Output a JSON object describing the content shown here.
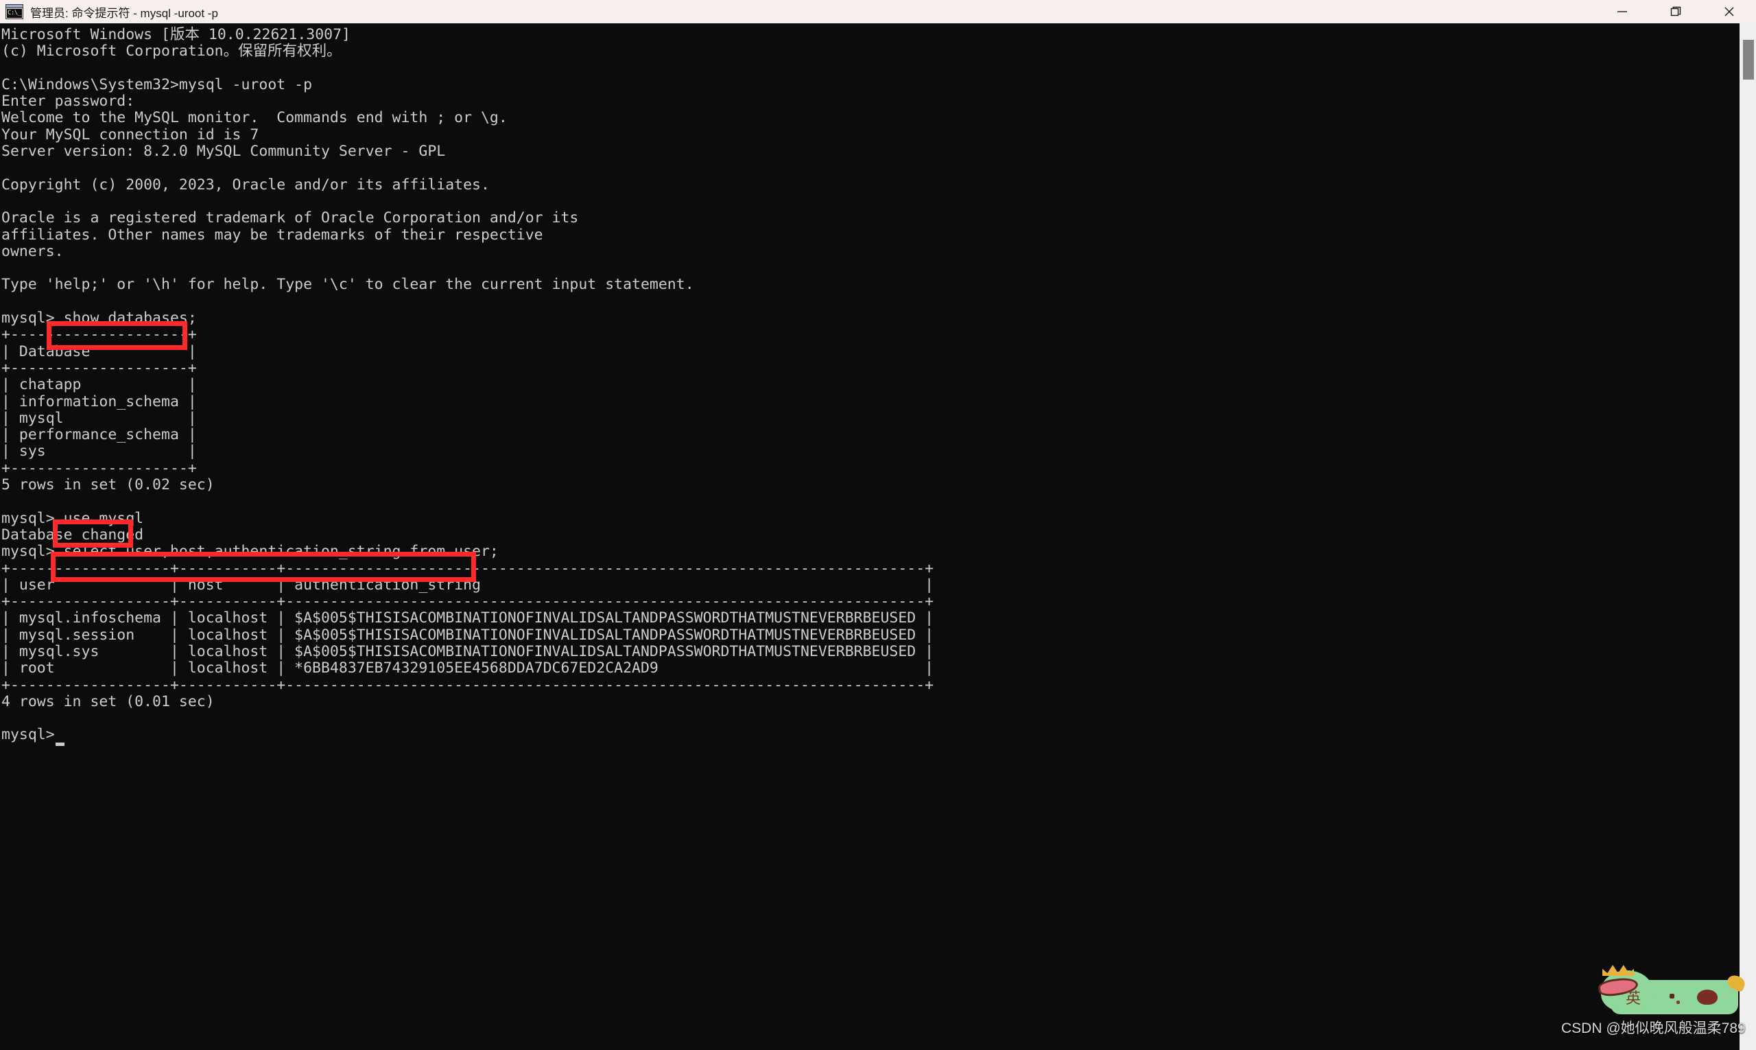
{
  "window": {
    "title": "管理员: 命令提示符 - mysql  -uroot -p",
    "icon": "cmd-icon",
    "icon_text": "C:\\_",
    "controls": [
      {
        "name": "minimize-button",
        "glyph": "minimize-icon"
      },
      {
        "name": "maximize-button",
        "glyph": "restore-icon"
      },
      {
        "name": "close-button",
        "glyph": "close-icon"
      }
    ]
  },
  "colors": {
    "titlebar_bg": "#f9eeee",
    "terminal_bg": "#0c0c0c",
    "terminal_fg": "#cccccc",
    "highlight_red": "#ff2b2b",
    "scrollbar_track": "#efefef",
    "scrollbar_thumb": "#848484",
    "ime_green": "#8fd79a"
  },
  "terminal": {
    "content": "Microsoft Windows [版本 10.0.22621.3007]\n(c) Microsoft Corporation。保留所有权利。\n\nC:\\Windows\\System32>mysql -uroot -p\nEnter password:\nWelcome to the MySQL monitor.  Commands end with ; or \\g.\nYour MySQL connection id is 7\nServer version: 8.2.0 MySQL Community Server - GPL\n\nCopyright (c) 2000, 2023, Oracle and/or its affiliates.\n\nOracle is a registered trademark of Oracle Corporation and/or its\naffiliates. Other names may be trademarks of their respective\nowners.\n\nType 'help;' or '\\h' for help. Type '\\c' to clear the current input statement.\n\nmysql> show databases;\n+--------------------+\n| Database           |\n+--------------------+\n| chatapp            |\n| information_schema |\n| mysql              |\n| performance_schema |\n| sys                |\n+--------------------+\n5 rows in set (0.02 sec)\n\nmysql> use mysql\nDatabase changed\nmysql> select user,host,authentication_string from user;\n+------------------+-----------+------------------------------------------------------------------------+\n| user             | host      | authentication_string                                                  |\n+------------------+-----------+------------------------------------------------------------------------+\n| mysql.infoschema | localhost | $A$005$THISISACOMBINATIONOFINVALIDSALTANDPASSWORDTHATMUSTNEVERBRBEUSED |\n| mysql.session    | localhost | $A$005$THISISACOMBINATIONOFINVALIDSALTANDPASSWORDTHATMUSTNEVERBRBEUSED |\n| mysql.sys        | localhost | $A$005$THISISACOMBINATIONOFINVALIDSALTANDPASSWORDTHATMUSTNEVERBRBEUSED |\n| root             | localhost | *6BB4837EB74329105EE4568DDA7DC67ED2CA2AD9                              |\n+------------------+-----------+------------------------------------------------------------------------+\n4 rows in set (0.01 sec)\n\nmysql> ",
    "prompt_lines": [
      "mysql> show databases;",
      "mysql> use mysql",
      "mysql> select user,host,authentication_string from user;",
      "mysql> "
    ],
    "commands_highlighted": [
      "show databases;",
      "use mysql",
      "select user,host,authentication_string from user;"
    ],
    "header_lines": [
      "Microsoft Windows [版本 10.0.22621.3007]",
      "(c) Microsoft Corporation。保留所有权利。",
      "C:\\Windows\\System32>mysql -uroot -p",
      "Enter password:"
    ],
    "mysql_banner": [
      "Welcome to the MySQL monitor.  Commands end with ; or \\g.",
      "Your MySQL connection id is 7",
      "Server version: 8.2.0 MySQL Community Server - GPL",
      "Copyright (c) 2000, 2023, Oracle and/or its affiliates.",
      "Oracle is a registered trademark of Oracle Corporation and/or its",
      "affiliates. Other names may be trademarks of their respective",
      "owners.",
      "Type 'help;' or '\\h' for help. Type '\\c' to clear the current input statement."
    ],
    "databases_table": {
      "columns": [
        "Database"
      ],
      "rows": [
        [
          "chatapp"
        ],
        [
          "information_schema"
        ],
        [
          "mysql"
        ],
        [
          "performance_schema"
        ],
        [
          "sys"
        ]
      ],
      "footer": "5 rows in set (0.02 sec)"
    },
    "database_changed": "Database changed",
    "user_table": {
      "columns": [
        "user",
        "host",
        "authentication_string"
      ],
      "rows": [
        [
          "mysql.infoschema",
          "localhost",
          "$A$005$THISISACOMBINATIONOFINVALIDSALTANDPASSWORDTHATMUSTNEVERBRBEUSED"
        ],
        [
          "mysql.session",
          "localhost",
          "$A$005$THISISACOMBINATIONOFINVALIDSALTANDPASSWORDTHATMUSTNEVERBRBEUSED"
        ],
        [
          "mysql.sys",
          "localhost",
          "$A$005$THISISACOMBINATIONOFINVALIDSALTANDPASSWORDTHATMUSTNEVERBRBEUSED"
        ],
        [
          "root",
          "localhost",
          "*6BB4837EB74329105EE4568DDA7DC67ED2CA2AD9"
        ]
      ],
      "footer": "4 rows in set (0.01 sec)"
    }
  },
  "watermark": {
    "text": "CSDN @她似晚风般温柔789",
    "ime_label": "英"
  }
}
